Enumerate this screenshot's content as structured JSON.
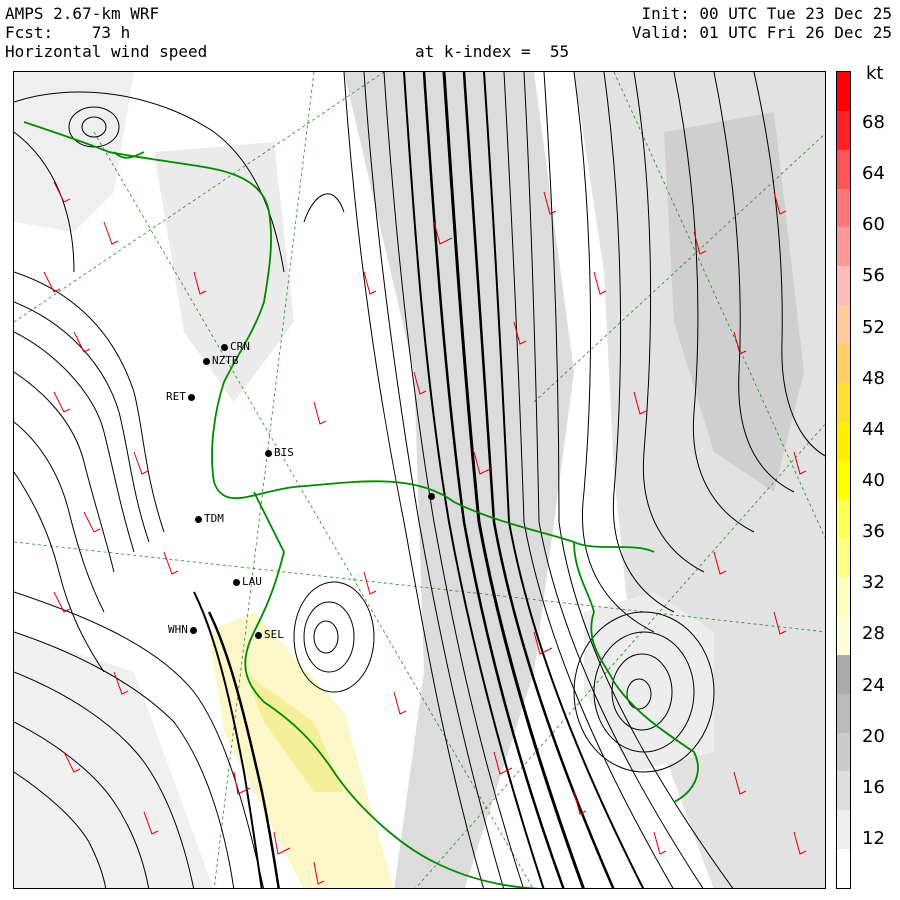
{
  "header": {
    "model": "AMPS 2.67-km WRF",
    "forecast": "Fcst:    73 h",
    "field": "Horizontal wind speed",
    "level": "at k-index =  55",
    "init": "Init: 00 UTC Tue 23 Dec 25",
    "valid": "Valid: 01 UTC Fri 26 Dec 25"
  },
  "stations": [
    {
      "code": "CRN"
    },
    {
      "code": "NZTB"
    },
    {
      "code": "RET"
    },
    {
      "code": "BIS"
    },
    {
      "code": "TDM"
    },
    {
      "code": "LAU"
    },
    {
      "code": "WHN"
    },
    {
      "code": "SEL"
    },
    {
      "code": ""
    }
  ],
  "colorbar": {
    "units": "kt",
    "labels": [
      "68",
      "64",
      "60",
      "56",
      "52",
      "48",
      "44",
      "40",
      "36",
      "32",
      "28",
      "24",
      "20",
      "16",
      "12"
    ],
    "colors": [
      "#ffffff",
      "#eeeeee",
      "#dddddd",
      "#cccccc",
      "#bbbbbb",
      "#aaaaaa",
      "#ffffd8",
      "#ffffbb",
      "#ffff88",
      "#ffff55",
      "#ffff00",
      "#ffee00",
      "#ffdd33",
      "#ffcc66",
      "#ffcc99",
      "#ffbbbb",
      "#ff9999",
      "#ff7777",
      "#ff5555",
      "#ff2222",
      "#ff0000"
    ]
  },
  "map_layers": {
    "streamline_color": "#000000",
    "coastline_color": "#008800",
    "wind_barb_color": "#dd0000",
    "grid_color": "#228822"
  }
}
